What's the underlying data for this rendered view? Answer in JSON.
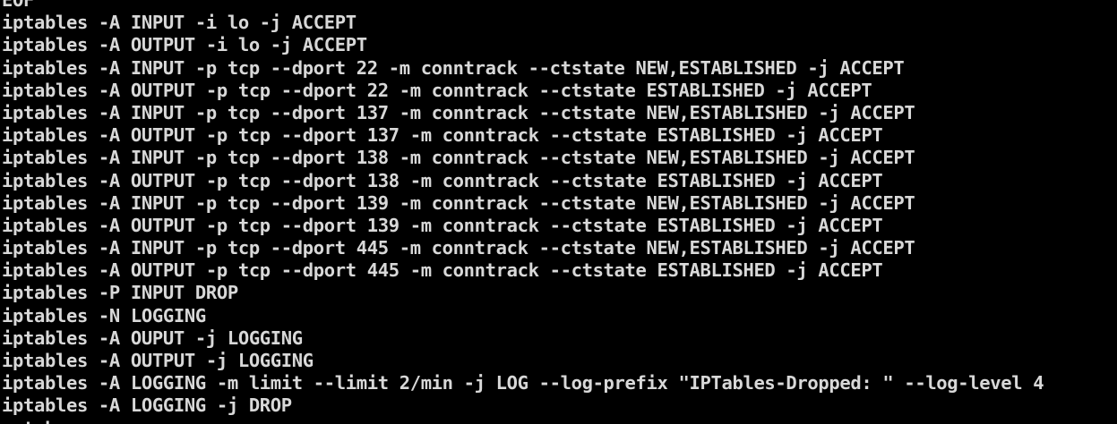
{
  "terminal": {
    "lines": [
      "EOF",
      "iptables -A INPUT -i lo -j ACCEPT",
      "iptables -A OUTPUT -i lo -j ACCEPT",
      "iptables -A INPUT -p tcp --dport 22 -m conntrack --ctstate NEW,ESTABLISHED -j ACCEPT",
      "iptables -A OUTPUT -p tcp --dport 22 -m conntrack --ctstate ESTABLISHED -j ACCEPT",
      "iptables -A INPUT -p tcp --dport 137 -m conntrack --ctstate NEW,ESTABLISHED -j ACCEPT",
      "iptables -A OUTPUT -p tcp --dport 137 -m conntrack --ctstate ESTABLISHED -j ACCEPT",
      "iptables -A INPUT -p tcp --dport 138 -m conntrack --ctstate NEW,ESTABLISHED -j ACCEPT",
      "iptables -A OUTPUT -p tcp --dport 138 -m conntrack --ctstate ESTABLISHED -j ACCEPT",
      "iptables -A INPUT -p tcp --dport 139 -m conntrack --ctstate NEW,ESTABLISHED -j ACCEPT",
      "iptables -A OUTPUT -p tcp --dport 139 -m conntrack --ctstate ESTABLISHED -j ACCEPT",
      "iptables -A INPUT -p tcp --dport 445 -m conntrack --ctstate NEW,ESTABLISHED -j ACCEPT",
      "iptables -A OUTPUT -p tcp --dport 445 -m conntrack --ctstate ESTABLISHED -j ACCEPT",
      "iptables -P INPUT DROP",
      "iptables -N LOGGING",
      "iptables -A OUPUT -j LOGGING",
      "iptables -A OUTPUT -j LOGGING",
      "iptables -A LOGGING -m limit --limit 2/min -j LOG --log-prefix \"IPTables-Dropped: \" --log-level 4",
      "iptables -A LOGGING -j DROP",
      "netsh"
    ],
    "colors": {
      "background": "#000000",
      "text": "#d8d8d8"
    }
  }
}
